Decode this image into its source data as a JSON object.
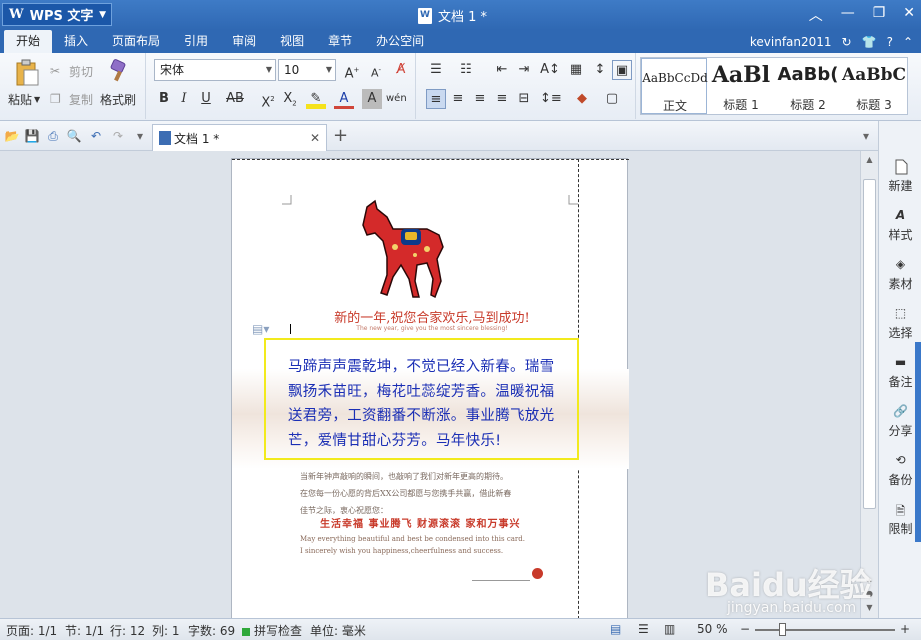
{
  "app": {
    "name": "WPS 文字",
    "doc_title": "文档 1 *",
    "user": "kevinfan2011"
  },
  "menu": {
    "tabs": [
      "开始",
      "插入",
      "页面布局",
      "引用",
      "审阅",
      "视图",
      "章节",
      "办公空间"
    ]
  },
  "ribbon": {
    "paste": "粘贴",
    "cut": "剪切",
    "copy": "复制",
    "format_painter": "格式刷",
    "font_name": "宋体",
    "font_size": "10",
    "styles": [
      {
        "sample": "AaBbCcDd",
        "label": "正文"
      },
      {
        "sample": "AaBl",
        "label": "标题 1"
      },
      {
        "sample": "AaBb(",
        "label": "标题 2"
      },
      {
        "sample": "AaBbC",
        "label": "标题 3"
      }
    ]
  },
  "doctab": {
    "title": "文档 1 *"
  },
  "document": {
    "greeting_cn": "新的一年,祝您合家欢乐,马到成功!",
    "greeting_en": "The new year, give you the most sincere blessing!",
    "poem": "马蹄声声震乾坤，不觉已经入新春。瑞雪飘扬禾苗旺，梅花吐蕊绽芳香。温暖祝福送君旁，工资翻番不断涨。事业腾飞放光芒，爱情甘甜心芬芳。马年快乐!",
    "small_lines": [
      "当新年钟声敲响的瞬间，也敲响了我们对新年更高的期待。",
      "在您每一份心愿的背后XX公司都愿与您携手共赢，借此新春",
      "佳节之际，衷心祝愿您："
    ],
    "slogan": "生活幸福  事业腾飞  财源滚滚  家和万事兴",
    "english_lines": [
      "May everything beautiful and best be condensed into this card.",
      "I sincerely wish you happiness,cheerfulness and success."
    ]
  },
  "taskpane": {
    "items": [
      "新建",
      "样式",
      "素材",
      "选择",
      "备注",
      "分享",
      "备份",
      "限制"
    ]
  },
  "status": {
    "page": "页面: 1/1",
    "section": "节: 1/1",
    "row": "行: 12",
    "col": "列: 1",
    "words": "字数: 69",
    "spell": "拼写检查",
    "unit": "单位: 毫米",
    "zoom": "50 %"
  },
  "watermark": {
    "brand": "Baidu经验",
    "url": "jingyan.baidu.com"
  },
  "colors": {
    "title_bar": "#2f68b3",
    "poem_text": "#1b2fb5",
    "highlight_box": "#f2ea1d",
    "greeting_red": "#c83a2a"
  }
}
